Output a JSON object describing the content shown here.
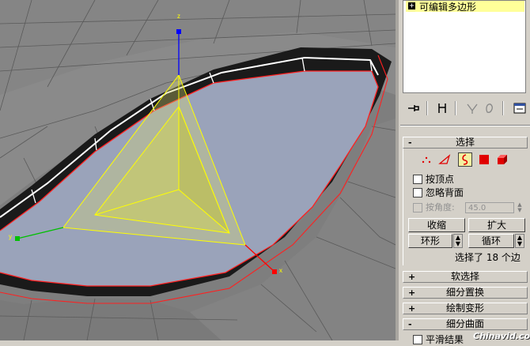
{
  "modifier_stack": {
    "items": [
      {
        "expander": "+",
        "label": "可编辑多边形"
      }
    ]
  },
  "stack_toolbar": {
    "icons": [
      "pin-stack-icon",
      "show-end-result-icon",
      "make-unique-icon",
      "remove-modifier-icon",
      "configure-modifier-sets-icon"
    ]
  },
  "viewport": {
    "axes": {
      "x": "x",
      "y": "y",
      "z": "z"
    },
    "colors": {
      "polygon_fill": "#9aa3ba",
      "selected_edge": "#ff2020",
      "gizmo": "#ffff00",
      "z_axis": "#0000ff",
      "y_axis": "#00c000",
      "x_axis": "#ff0000",
      "background": "#808080"
    }
  },
  "selection_rollout": {
    "expander": "-",
    "title": "选择",
    "subobject_icons": [
      "vertex-icon",
      "edge-icon",
      "border-icon",
      "polygon-icon",
      "element-icon"
    ],
    "active_subobject": "border-icon",
    "by_vertex_label": "按顶点",
    "ignore_backfacing_label": "忽略背面",
    "by_angle_label": "按角度:",
    "by_angle_value": "45.0",
    "shrink_label": "收缩",
    "grow_label": "扩大",
    "ring_label": "环形",
    "loop_label": "循环",
    "status_text": "选择了 18 个边"
  },
  "rollouts": [
    {
      "expander": "+",
      "title": "软选择"
    },
    {
      "expander": "+",
      "title": "细分置换"
    },
    {
      "expander": "+",
      "title": "绘制变形"
    },
    {
      "expander": "-",
      "title": "细分曲面"
    }
  ],
  "partial_checkbox_label": "平滑结果",
  "watermark": "Chinavid.com"
}
